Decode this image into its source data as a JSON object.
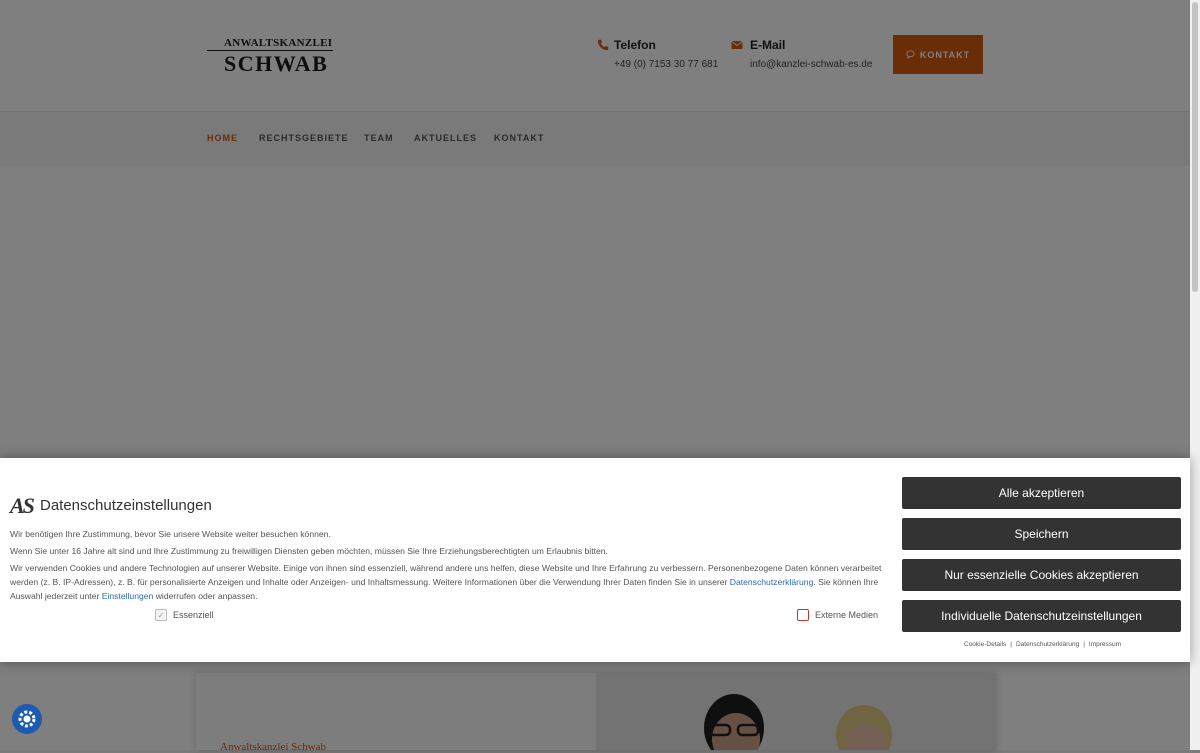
{
  "logo": {
    "top_text": "ANWALTSKANZLEI",
    "main_text": "SCHWAB"
  },
  "header": {
    "phone": {
      "title": "Telefon",
      "value": "+49 (0) 7153 30 77 681",
      "icon": "phone-icon"
    },
    "email": {
      "title": "E-Mail",
      "value": "info@kanzlei-schwab-es.de",
      "icon": "envelope-icon"
    },
    "contact_button": "KONTAKT"
  },
  "nav": {
    "items": [
      {
        "label": "HOME",
        "active": true
      },
      {
        "label": "RECHTSGEBIETE",
        "active": false
      },
      {
        "label": "TEAM",
        "active": false
      },
      {
        "label": "AKTUELLES",
        "active": false
      },
      {
        "label": "KONTAKT",
        "active": false
      }
    ]
  },
  "card": {
    "kicker": "Anwaltskanzlei Schwab"
  },
  "cookie": {
    "logo": "AS",
    "title": "Datenschutzeinstellungen",
    "p1": "Wir benötigen Ihre Zustimmung, bevor Sie unsere Website weiter besuchen können.",
    "p2": "Wenn Sie unter 16 Jahre alt sind und Ihre Zustimmung zu freiwilligen Diensten geben möchten, müssen Sie Ihre Erziehungsberechtigten um Erlaubnis bitten.",
    "p3_a": "Wir verwenden Cookies und andere Technologien auf unserer Website. Einige von ihnen sind essenziell, während andere uns helfen, diese Website und Ihre Erfahrung zu verbessern. Personenbezogene Daten können verarbeitet werden (z. B. IP-Adressen), z. B. für personalisierte Anzeigen und Inhalte oder Anzeigen- und Inhaltsmessung. Weitere Informationen über die Verwendung Ihrer Daten finden Sie in unserer ",
    "p3_link": "Datenschutzerklärung",
    "p3_b": ". Sie können Ihre Auswahl jederzeit unter ",
    "p3_link2": "Einstellungen",
    "p3_c": " widerrufen oder anpassen.",
    "check_essential": "Essenziell",
    "check_external": "Externe Medien",
    "buttons": {
      "accept_all": "Alle akzeptieren",
      "save": "Speichern",
      "essential_only": "Nur essenzielle Cookies akzeptieren",
      "individual": "Individuelle Datenschutzeinstellungen"
    },
    "links": {
      "details": "Cookie-Details",
      "privacy": "Datenschutzerklärung",
      "imprint": "Impressum",
      "sep": "|"
    }
  },
  "colors": {
    "accent": "#d25a10",
    "button_dark": "#333333",
    "link": "#2a6ab5",
    "fab": "#1d5bb0"
  }
}
